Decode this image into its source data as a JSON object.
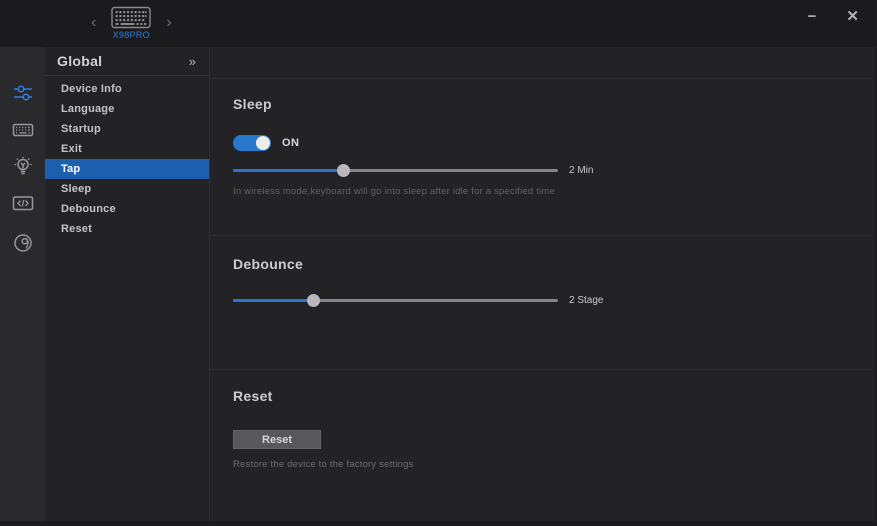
{
  "titlebar": {
    "device_name": "X98PRO",
    "prev_icon": "‹",
    "next_icon": "›",
    "minimize_icon": "−",
    "close_icon": "✕"
  },
  "nav_sidebar": {
    "active_index": 0,
    "items": [
      {
        "icon": "settings-sliders-icon"
      },
      {
        "icon": "keyboard-icon"
      },
      {
        "icon": "lighting-icon"
      },
      {
        "icon": "macro-icon"
      },
      {
        "icon": "performance-icon"
      }
    ]
  },
  "menu": {
    "header": "Global",
    "collapse_icon": "»",
    "items": [
      {
        "label": "Device Info",
        "selected": false
      },
      {
        "label": "Language",
        "selected": false
      },
      {
        "label": "Startup",
        "selected": false
      },
      {
        "label": "Exit",
        "selected": false
      },
      {
        "label": "Tap",
        "selected": true
      },
      {
        "label": "Sleep",
        "selected": false
      },
      {
        "label": "Debounce",
        "selected": false
      },
      {
        "label": "Reset",
        "selected": false
      }
    ]
  },
  "sections": {
    "sleep": {
      "title": "Sleep",
      "toggle_on": true,
      "toggle_label": "ON",
      "slider": {
        "value_label": "2 Min",
        "percent": 34
      },
      "description": "In wireless mode,keyboard will go into sleep after idle for a specified time"
    },
    "debounce": {
      "title": "Debounce",
      "slider": {
        "value_label": "2 Stage",
        "percent": 25
      }
    },
    "reset": {
      "title": "Reset",
      "button_label": "Reset",
      "description": "Restore the device to the factory settings"
    }
  },
  "colors": {
    "accent_blue": "#2e7ee0",
    "toggle_blue": "#2878cc",
    "slider_fill_blue": "#2d74cc",
    "selected_item_bg": "#1b5fae",
    "topbar_bg": "#1b1b1d",
    "iconbar_bg": "#2a2a2c",
    "panel_bg": "#232325",
    "divider": "#2f2f31"
  }
}
